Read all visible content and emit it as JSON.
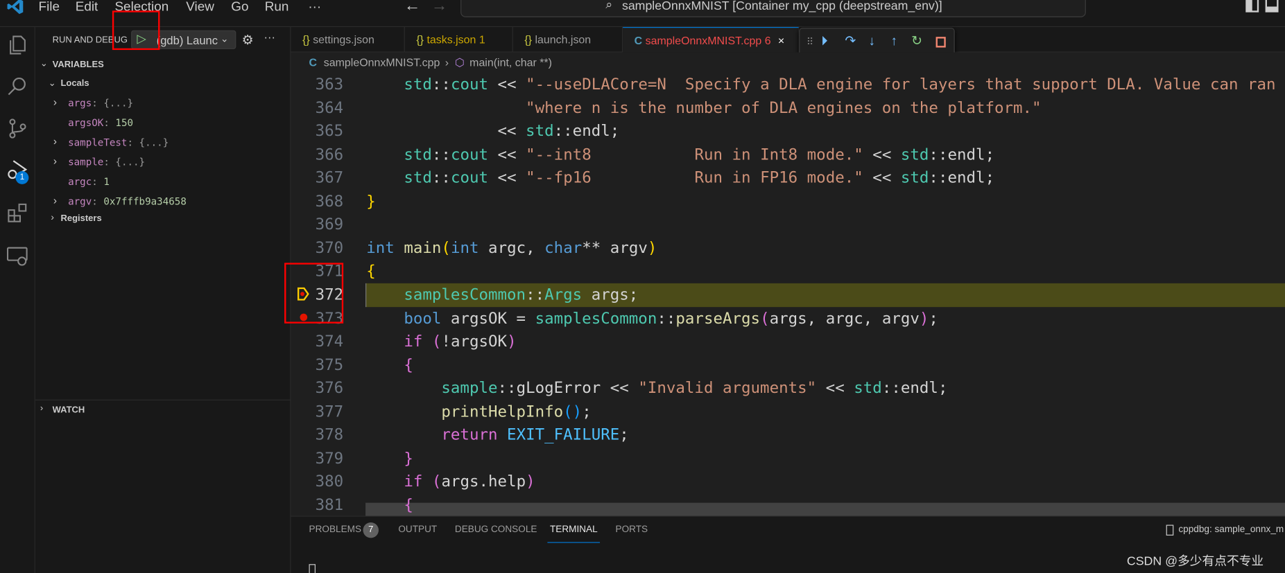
{
  "menu": [
    "File",
    "Edit",
    "Selection",
    "View",
    "Go",
    "Run",
    "···"
  ],
  "window_title": "sampleOnnxMNIST [Container my_cpp (deepstream_env)]",
  "activity_badge": "1",
  "sidebar": {
    "title": "RUN AND DEBUG",
    "config": "(gdb) Launc",
    "variables_header": "VARIABLES",
    "locals_label": "Locals",
    "variables": [
      {
        "name": "args",
        "value": "{...}",
        "expandable": true
      },
      {
        "name": "argsOK",
        "value": "150",
        "expandable": false
      },
      {
        "name": "sampleTest",
        "value": "{...}",
        "expandable": true
      },
      {
        "name": "sample",
        "value": "{...}",
        "expandable": true
      },
      {
        "name": "argc",
        "value": "1",
        "expandable": false
      },
      {
        "name": "argv",
        "value": "0x7fffb9a34658",
        "expandable": true
      }
    ],
    "registers_label": "Registers",
    "watch_header": "WATCH"
  },
  "tabs": [
    {
      "label": "settings.json",
      "badge": ""
    },
    {
      "label": "tasks.json",
      "badge": "1"
    },
    {
      "label": "launch.json",
      "badge": ""
    },
    {
      "label": "sampleOnnxMNIST.cpp",
      "badge": "6"
    }
  ],
  "breadcrumb": {
    "file": "sampleOnnxMNIST.cpp",
    "symbol": "main(int, char **)"
  },
  "code": {
    "current_line": "372",
    "lines": [
      {
        "n": "363",
        "t": [
          [
            "    ",
            "p"
          ],
          [
            "std",
            "ns"
          ],
          [
            "::",
            "p"
          ],
          [
            "cout",
            "ns"
          ],
          [
            " << ",
            "p"
          ],
          [
            "\"--useDLACore=N  Specify a DLA engine for layers that support DLA. Value can ran",
            "str"
          ]
        ]
      },
      {
        "n": "364",
        "t": [
          [
            "                 ",
            "p"
          ],
          [
            "\"where n is the number of DLA engines on the platform.\"",
            "str"
          ]
        ]
      },
      {
        "n": "365",
        "t": [
          [
            "              << ",
            "p"
          ],
          [
            "std",
            "ns"
          ],
          [
            "::",
            "p"
          ],
          [
            "endl",
            "id"
          ],
          [
            ";",
            "p"
          ]
        ]
      },
      {
        "n": "366",
        "t": [
          [
            "    ",
            "p"
          ],
          [
            "std",
            "ns"
          ],
          [
            "::",
            "p"
          ],
          [
            "cout",
            "ns"
          ],
          [
            " << ",
            "p"
          ],
          [
            "\"--int8           Run in Int8 mode.\"",
            "str"
          ],
          [
            " << ",
            "p"
          ],
          [
            "std",
            "ns"
          ],
          [
            "::",
            "p"
          ],
          [
            "endl",
            "id"
          ],
          [
            ";",
            "p"
          ]
        ]
      },
      {
        "n": "367",
        "t": [
          [
            "    ",
            "p"
          ],
          [
            "std",
            "ns"
          ],
          [
            "::",
            "p"
          ],
          [
            "cout",
            "ns"
          ],
          [
            " << ",
            "p"
          ],
          [
            "\"--fp16           Run in FP16 mode.\"",
            "str"
          ],
          [
            " << ",
            "p"
          ],
          [
            "std",
            "ns"
          ],
          [
            "::",
            "p"
          ],
          [
            "endl",
            "id"
          ],
          [
            ";",
            "p"
          ]
        ]
      },
      {
        "n": "368",
        "t": [
          [
            "}",
            "b1"
          ]
        ]
      },
      {
        "n": "369",
        "t": []
      },
      {
        "n": "370",
        "t": [
          [
            "int",
            "kw"
          ],
          [
            " ",
            "p"
          ],
          [
            "main",
            "fn"
          ],
          [
            "(",
            "b1"
          ],
          [
            "int",
            "kw"
          ],
          [
            " argc, ",
            "id"
          ],
          [
            "char",
            "kw"
          ],
          [
            "** argv",
            "id"
          ],
          [
            ")",
            "b1"
          ]
        ]
      },
      {
        "n": "371",
        "t": [
          [
            "{",
            "b1"
          ]
        ]
      },
      {
        "n": "372",
        "t": [
          [
            "    ",
            "p"
          ],
          [
            "samplesCommon",
            "ns"
          ],
          [
            "::",
            "p"
          ],
          [
            "Args",
            "ns"
          ],
          [
            " args;",
            "id"
          ]
        ]
      },
      {
        "n": "373",
        "t": [
          [
            "    ",
            "p"
          ],
          [
            "bool",
            "kw"
          ],
          [
            " argsOK = ",
            "id"
          ],
          [
            "samplesCommon",
            "ns"
          ],
          [
            "::",
            "p"
          ],
          [
            "parseArgs",
            "fn"
          ],
          [
            "(",
            "b2"
          ],
          [
            "args, argc, argv",
            "id"
          ],
          [
            ")",
            "b2"
          ],
          [
            ";",
            "p"
          ]
        ]
      },
      {
        "n": "374",
        "t": [
          [
            "    ",
            "p"
          ],
          [
            "if",
            "b2"
          ],
          [
            " ",
            "p"
          ],
          [
            "(",
            "b2"
          ],
          [
            "!argsOK",
            "id"
          ],
          [
            ")",
            "b2"
          ]
        ]
      },
      {
        "n": "375",
        "t": [
          [
            "    ",
            "p"
          ],
          [
            "{",
            "b2"
          ]
        ]
      },
      {
        "n": "376",
        "t": [
          [
            "        ",
            "p"
          ],
          [
            "sample",
            "ns"
          ],
          [
            "::",
            "p"
          ],
          [
            "gLogError",
            "id"
          ],
          [
            " << ",
            "p"
          ],
          [
            "\"Invalid arguments\"",
            "str"
          ],
          [
            " << ",
            "p"
          ],
          [
            "std",
            "ns"
          ],
          [
            "::",
            "p"
          ],
          [
            "endl",
            "id"
          ],
          [
            ";",
            "p"
          ]
        ]
      },
      {
        "n": "377",
        "t": [
          [
            "        ",
            "p"
          ],
          [
            "printHelpInfo",
            "fn"
          ],
          [
            "()",
            "b3"
          ],
          [
            ";",
            "p"
          ]
        ]
      },
      {
        "n": "378",
        "t": [
          [
            "        ",
            "p"
          ],
          [
            "return",
            "b2"
          ],
          [
            " ",
            "p"
          ],
          [
            "EXIT_FAILURE",
            "mac"
          ],
          [
            ";",
            "p"
          ]
        ]
      },
      {
        "n": "379",
        "t": [
          [
            "    ",
            "p"
          ],
          [
            "}",
            "b2"
          ]
        ]
      },
      {
        "n": "380",
        "t": [
          [
            "    ",
            "p"
          ],
          [
            "if",
            "b2"
          ],
          [
            " ",
            "p"
          ],
          [
            "(",
            "b2"
          ],
          [
            "args.help",
            "id"
          ],
          [
            ")",
            "b2"
          ]
        ]
      },
      {
        "n": "381",
        "t": [
          [
            "    ",
            "p"
          ],
          [
            "{",
            "b2"
          ]
        ]
      }
    ]
  },
  "panel": {
    "tabs": [
      "PROBLEMS",
      "OUTPUT",
      "DEBUG CONSOLE",
      "TERMINAL",
      "PORTS"
    ],
    "problems_count": "7",
    "terminal_name": "cppdbg: sample_onnx_m"
  },
  "watermark": "CSDN @多少有点不专业"
}
